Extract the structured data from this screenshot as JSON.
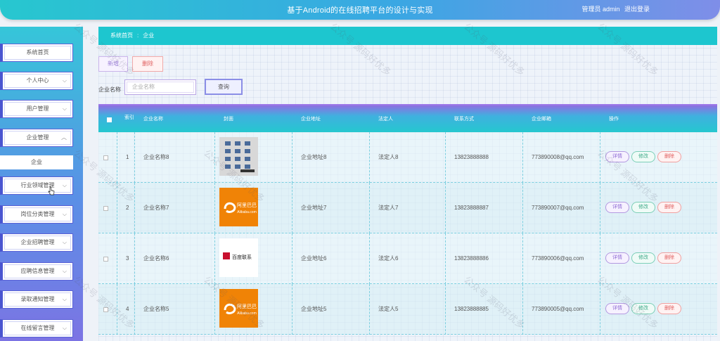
{
  "header": {
    "title": "基于Android的在线招聘平台的设计与实现",
    "role": "管理员 admin",
    "logout": "退出登录"
  },
  "sidebar": {
    "items": [
      {
        "label": "系统首页",
        "chevron": false
      },
      {
        "label": "个人中心",
        "chevron": true
      },
      {
        "label": "用户管理",
        "chevron": true
      },
      {
        "label": "企业管理",
        "chevron": true,
        "expanded": true
      },
      {
        "label": "行业领域管理",
        "chevron": true
      },
      {
        "label": "岗位分类管理",
        "chevron": true
      },
      {
        "label": "企业招聘管理",
        "chevron": true
      },
      {
        "label": "应聘信息管理",
        "chevron": true
      },
      {
        "label": "录取通知管理",
        "chevron": true
      },
      {
        "label": "在线留言管理",
        "chevron": true
      }
    ],
    "submenu": {
      "label": "企业"
    }
  },
  "breadcrumb": {
    "home": "系统首页",
    "separator": ":",
    "current": "企业"
  },
  "toolbar": {
    "add_label": "新增",
    "delete_label": "删除"
  },
  "search": {
    "label": "企业名称",
    "placeholder": "企业名称",
    "button": "查询"
  },
  "table": {
    "headers": [
      "索引",
      "企业名称",
      "封面",
      "企业地址",
      "法定人",
      "联系方式",
      "企业邮箱",
      "操作"
    ],
    "rows": [
      {
        "index": "1",
        "name": "企业名称8",
        "cover": "grid-logo",
        "address": "企业地址8",
        "legal": "法定人8",
        "phone": "13823888888",
        "email": "773890008@qq.com"
      },
      {
        "index": "2",
        "name": "企业名称7",
        "cover": "alibaba",
        "address": "企业地址7",
        "legal": "法定人7",
        "phone": "13823888887",
        "email": "773890007@qq.com"
      },
      {
        "index": "3",
        "name": "企业名称6",
        "cover": "baidu-like",
        "address": "企业地址6",
        "legal": "法定人6",
        "phone": "13823888886",
        "email": "773890006@qq.com"
      },
      {
        "index": "4",
        "name": "企业名称5",
        "cover": "alibaba",
        "address": "企业地址5",
        "legal": "法定人5",
        "phone": "13823888885",
        "email": "773890005@qq.com"
      }
    ],
    "actions": {
      "detail": "详情",
      "edit": "修改",
      "delete": "删除"
    }
  },
  "logos": {
    "alibaba_cn": "阿里巴巴",
    "alibaba_sub": "Alibaba.com",
    "baidu_cn": "百度联系"
  },
  "watermark": "公众号 源码好优多",
  "colors": {
    "accent": "#1dc6cf",
    "sidebar_top": "#35c6d9",
    "sidebar_bottom": "#7c74e4",
    "header_purple": "#8e6fe0"
  }
}
